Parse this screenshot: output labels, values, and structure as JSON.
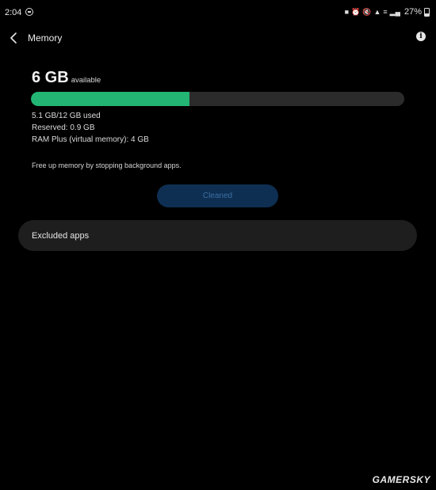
{
  "status_bar": {
    "time": "2:04",
    "icons": [
      "lock-icon",
      "alarm-icon",
      "mute-icon",
      "wifi-icon",
      "volte-icon",
      "signal-icon"
    ],
    "battery_percent": "27%"
  },
  "header": {
    "title": "Memory",
    "back_icon": "chevron-left-icon",
    "info_icon": "info-icon",
    "info_glyph": "i"
  },
  "memory": {
    "available_value": "6 GB",
    "available_label": "available",
    "used_fraction": 0.425,
    "bar_fill_color": "#22b573",
    "details": [
      "5.1 GB/12 GB used",
      "Reserved: 0.9 GB",
      "RAM Plus (virtual memory): 4 GB"
    ],
    "free_up_text": "Free up memory by stopping background apps.",
    "clean_button_label": "Cleaned"
  },
  "excluded_apps": {
    "label": "Excluded apps"
  },
  "watermark": "GAMERSKY"
}
